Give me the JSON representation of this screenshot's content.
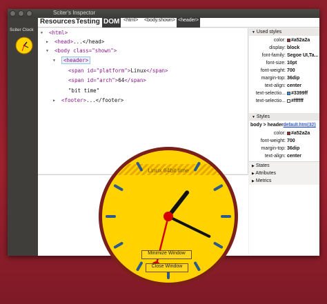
{
  "window": {
    "title": "Sciter's Inspector"
  },
  "left_panel": {
    "app_name": "Sciter Clock"
  },
  "tabs": {
    "resources": "Resources",
    "testing": "Testing",
    "dom": "DOM",
    "crumbs": [
      "<html>",
      "<body.shown>",
      "<header>"
    ]
  },
  "dom_tree": [
    {
      "toggle": "▼",
      "tag": "<html>"
    },
    {
      "toggle": "▶",
      "tag": "<head>",
      "rest": "...</head>"
    },
    {
      "toggle": "▼",
      "tag": "<body",
      "attr": " class=",
      "value": "\"shown\"",
      "close": ">"
    },
    {
      "toggle": "▼",
      "tag": "<header>"
    },
    {
      "tag": "<span",
      "attr": " id=",
      "value": "\"platform\"",
      "close": ">",
      "text": "Linux",
      "end": "</span>"
    },
    {
      "tag": "<span",
      "attr": " id=",
      "value": "\"arch\"",
      "close": ">",
      "text": "64",
      "end": "</span>"
    },
    {
      "text": "\"bit time\""
    },
    {
      "toggle": "▶",
      "tag": "<footer>",
      "rest": "...</footer>"
    }
  ],
  "used_styles": {
    "title": "Used styles",
    "rows": [
      {
        "k": "color:",
        "v": "#a52a2a",
        "swatch": "#a52a2a"
      },
      {
        "k": "display:",
        "v": "block"
      },
      {
        "k": "font-family:",
        "v": "Segoe UI,Ta..."
      },
      {
        "k": "font-size:",
        "v": "10pt"
      },
      {
        "k": "font-weight:",
        "v": "700"
      },
      {
        "k": "margin-top:",
        "v": "36dip"
      },
      {
        "k": "text-align:",
        "v": "center"
      },
      {
        "k": "text-selectio...",
        "v": "#3399ff",
        "swatch": "#3399ff"
      },
      {
        "k": "text-selectio...",
        "v": "#ffffff",
        "swatch": "#ffffff"
      }
    ]
  },
  "styles": {
    "title": "Styles",
    "selector": "body > header",
    "source": "default.htm(32)",
    "rows": [
      {
        "k": "color:",
        "v": "#a52a2a",
        "swatch": "#a52a2a"
      },
      {
        "k": "font-weight:",
        "v": "700"
      },
      {
        "k": "margin-top:",
        "v": "36dip"
      },
      {
        "k": "text-align:",
        "v": "center"
      }
    ]
  },
  "collapsed_sections": [
    "States",
    "Attributes",
    "Metrics"
  ],
  "clock": {
    "header_text": "Linux 64bit time",
    "hour_hand_deg": 38,
    "minute_hand_deg": 116,
    "second_hand_deg": 194,
    "buttons": {
      "minimize": "Minimize Window",
      "close": "Close Window"
    },
    "colors": {
      "face": "#ffd200",
      "rim": "#7a1f1a",
      "marker": "#2c5b8a",
      "hands": "#111111",
      "second": "#d40000"
    }
  }
}
